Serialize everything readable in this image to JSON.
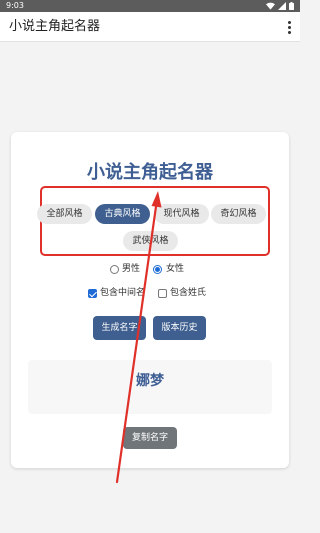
{
  "status_bar": {
    "time": "9:03"
  },
  "app_bar": {
    "title": "小说主角起名器"
  },
  "card": {
    "heading": "小说主角起名器",
    "styles": [
      {
        "label": "全部风格",
        "selected": false
      },
      {
        "label": "古典风格",
        "selected": true
      },
      {
        "label": "现代风格",
        "selected": false
      },
      {
        "label": "奇幻风格",
        "selected": false
      },
      {
        "label": "武侠风格",
        "selected": false
      }
    ],
    "gender": {
      "male_label": "男性",
      "female_label": "女性",
      "selected": "女性"
    },
    "options": {
      "middle_name_label": "包含中间名",
      "middle_name_checked": true,
      "surname_label": "包含姓氏",
      "surname_checked": false
    },
    "buttons": {
      "generate": "生成名字",
      "history": "版本历史",
      "copy": "复制名字"
    },
    "result": {
      "name": "娜梦"
    }
  },
  "colors": {
    "primary": "#3e5f8f",
    "heading": "#3f5f94",
    "highlight": "#e0302a",
    "copy_button": "#707579"
  }
}
